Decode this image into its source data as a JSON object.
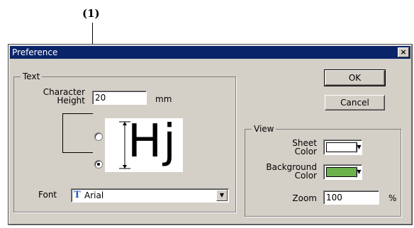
{
  "callout": {
    "label": "(1)"
  },
  "window": {
    "title": "Preference",
    "close_glyph": "×"
  },
  "text_group": {
    "legend": "Text",
    "char_height_line1": "Character",
    "char_height_line2": "Height",
    "char_height_value": "20",
    "unit": "mm",
    "preview_text": "Hj",
    "radio_top_selected": false,
    "radio_bottom_selected": true,
    "font_label": "Font",
    "font_value": "Arial",
    "font_icon": "truetype-font-icon"
  },
  "buttons": {
    "ok": "OK",
    "cancel": "Cancel"
  },
  "view_group": {
    "legend": "View",
    "sheet_color_line1": "Sheet",
    "sheet_color_line2": "Color",
    "sheet_color_hex": "#ffffff",
    "bg_color_line1": "Background",
    "bg_color_line2": "Color",
    "bg_color_hex": "#6cb24c",
    "zoom_label": "Zoom",
    "zoom_value": "100",
    "zoom_unit": "%"
  }
}
